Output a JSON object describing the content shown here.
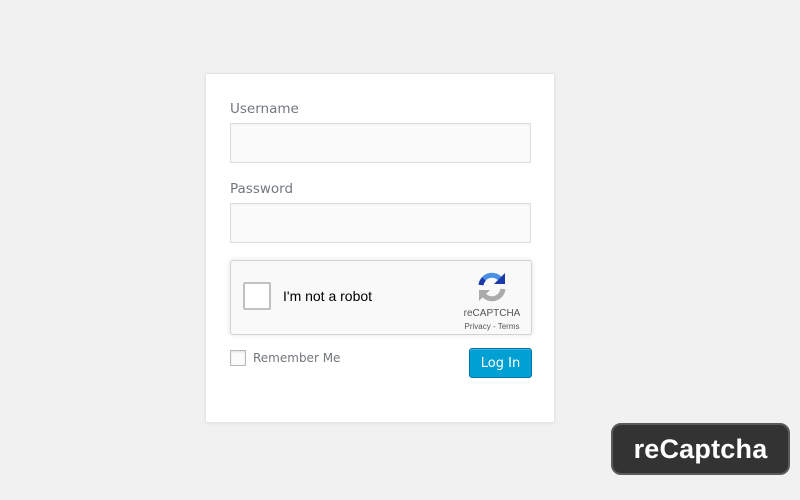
{
  "login_form": {
    "username_label": "Username",
    "username_value": "",
    "password_label": "Password",
    "password_value": "",
    "remember_label": "Remember Me",
    "remember_checked": false,
    "submit_label": "Log In"
  },
  "recaptcha": {
    "checkbox_label": "I'm not a robot",
    "checked": false,
    "brand": "reCAPTCHA",
    "privacy_link": "Privacy",
    "separator": " - ",
    "terms_link": "Terms",
    "icon": "recaptcha-logo-icon"
  },
  "watermark": {
    "text": "reCaptcha"
  },
  "colors": {
    "background": "#f1f1f1",
    "card": "#ffffff",
    "button": "#00a0d2",
    "recaptcha_blue": "#4a90e2",
    "recaptcha_dark_blue": "#1c3aa9",
    "recaptcha_gray": "#ababab",
    "badge": "#333333"
  }
}
